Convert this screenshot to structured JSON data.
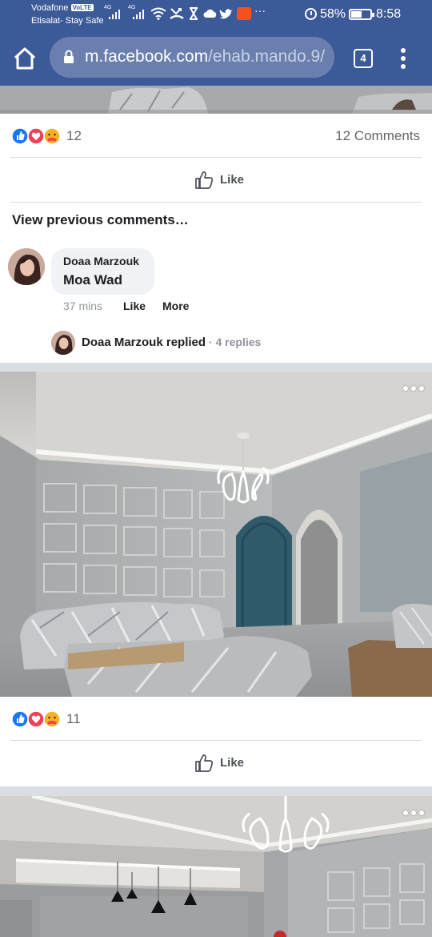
{
  "status_bar": {
    "carrier_1": "Vodafone",
    "carrier_1_badge": "VoLTE",
    "carrier_2": "Etisalat- Stay Safe",
    "signal_1_label": "4G",
    "signal_2_label": "4G",
    "overflow": "···",
    "battery_percent": "58%",
    "battery_level": 0.58,
    "time": "8:58",
    "icons": [
      "wifi-icon",
      "missed-call-icon",
      "hourglass-icon",
      "cloud-icon",
      "twitter-icon",
      "app-notification-icon",
      "alarm-icon",
      "battery-icon"
    ]
  },
  "browser": {
    "url_host": "m.facebook.com",
    "url_path": "/ehab.mando.9/",
    "tab_count": "4",
    "theme_color": "#3d5a98"
  },
  "post_1": {
    "reaction_count": "12",
    "comments_count": "12 Comments",
    "like_label": "Like",
    "view_previous": "View previous comments…",
    "comment": {
      "author": "Doaa Marzouk",
      "text": "Moa Wad",
      "time": "37 mins",
      "like_label": "Like",
      "more_label": "More"
    },
    "reply": {
      "author_replied": "Doaa Marzouk replied",
      "separator": " · ",
      "count": "4 replies"
    }
  },
  "post_2": {
    "reaction_count": "11",
    "like_label": "Like"
  },
  "reaction_colors": {
    "like": "#1877f2",
    "love": "#f33e58",
    "care": "#f7b125"
  }
}
